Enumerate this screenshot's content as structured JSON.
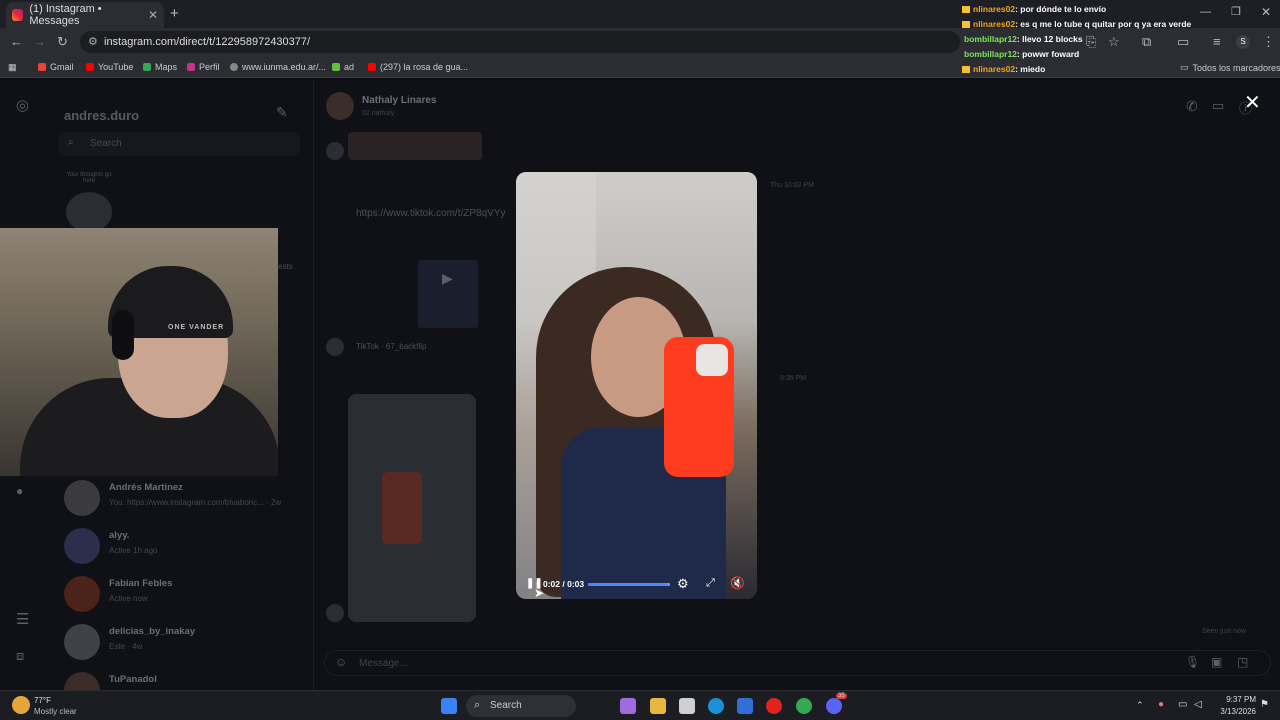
{
  "browser": {
    "tab_title": "(1) Instagram • Messages",
    "url": "instagram.com/direct/t/122958972430377/",
    "profile_initial": "S",
    "bookmarks": [
      "Gmail",
      "YouTube",
      "Maps",
      "Perfil",
      "www.iunma.edu.ar/...",
      "ad",
      "(297) la rosa de gua..."
    ],
    "all_bookmarks": "Todos los marcadores"
  },
  "chat_overlay": [
    {
      "user": "nlinares02",
      "msg": ": por dónde te lo envío",
      "color": "#f2a51a",
      "badge": true
    },
    {
      "user": "nlinares02",
      "msg": ": es q me lo tube q quitar por q ya era verde",
      "color": "#f2a51a",
      "badge": true
    },
    {
      "user": "bombillapr12",
      "msg": ": llevo 12 blocks",
      "color": "#7fe35a",
      "badge": false
    },
    {
      "user": "bombillapr12",
      "msg": ": powwr foward",
      "color": "#7fe35a",
      "badge": false
    },
    {
      "user": "nlinares02",
      "msg": ": miedo",
      "color": "#f2a51a",
      "badge": true
    }
  ],
  "inbox": {
    "username": "andres.duro",
    "search_placeholder": "Search",
    "note_text": "Your thoughts go here",
    "requests_label": "ests",
    "conversations": [
      {
        "name": "Andrés Martínez",
        "sub": "You: https://www.instagram.com/trivabonc...",
        "time": "· 2w"
      },
      {
        "name": "alyy.",
        "sub": "Active 1h ago",
        "time": ""
      },
      {
        "name": "Fabian Febles",
        "sub": "Active now",
        "time": ""
      },
      {
        "name": "delicias_by_inakay",
        "sub": "Este · 4w",
        "time": ""
      },
      {
        "name": "TuPanadol",
        "sub": "",
        "time": ""
      }
    ]
  },
  "thread": {
    "name": "Nathaly Linares",
    "handle": "02.nathaly",
    "link": "https://www.tiktok.com/t/ZP8qVYy",
    "tiktok_caption": "TikTok · 67_backflip",
    "time1": "Thu 10:02 PM",
    "time2": "9:36 PM",
    "seen": "Seen just now",
    "message_placeholder": "Message..."
  },
  "webcam": {
    "beanie_text": "ONE VANDER"
  },
  "video_player": {
    "time": "0:02 / 0:03",
    "progress": 0.97
  },
  "taskbar": {
    "weather_temp": "77°F",
    "weather_desc": "Mostly clear",
    "search": "Search",
    "time": "9:37 PM",
    "date": "3/13/2026",
    "discord_badge": "35"
  }
}
